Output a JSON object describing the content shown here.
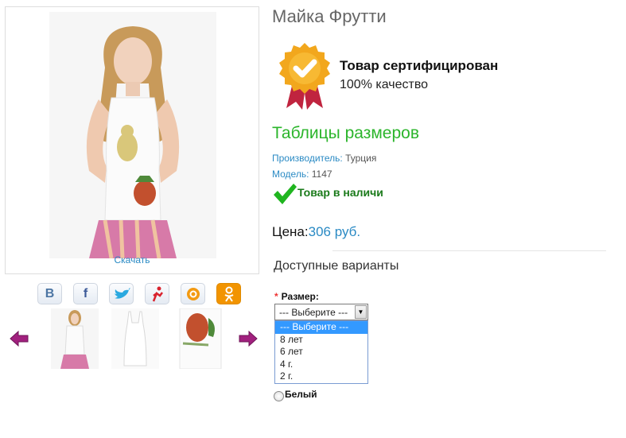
{
  "product": {
    "title": "Майка Фрутти",
    "download_label": "Скачать"
  },
  "social": [
    {
      "name": "vk-icon",
      "glyph": "В",
      "color": "#4c75a3"
    },
    {
      "name": "facebook-icon",
      "glyph": "f",
      "color": "#3b5998"
    },
    {
      "name": "twitter-icon",
      "glyph": "🐦",
      "color": "#2aa9e0"
    },
    {
      "name": "moimir-icon",
      "glyph": "я",
      "color": "#d9232e"
    },
    {
      "name": "mailru-icon",
      "glyph": "@",
      "color": "#f39a12"
    },
    {
      "name": "odnoklassniki-icon",
      "glyph": "ок",
      "color": "#ffffff"
    }
  ],
  "certificate": {
    "title": "Товар сертифицирован",
    "subtitle": "100% качество"
  },
  "sizes_link": "Таблицы размеров",
  "meta": {
    "manufacturer_label": "Производитель:",
    "manufacturer": "Турция",
    "model_label": "Модель:",
    "model": "1147"
  },
  "stock": "Товар в наличи",
  "price": {
    "label": "Цена:",
    "value": "306 руб."
  },
  "variants": {
    "heading": "Доступные варианты",
    "size_label": "Размер:",
    "required_mark": "*",
    "selected": "--- Выберите ---",
    "options": [
      "--- Выберите ---",
      "8 лет",
      "6 лет",
      "4 г.",
      "2 г."
    ],
    "color_option": "Белый"
  },
  "colors": {
    "link": "#2a8ac4",
    "green": "#2bb52b",
    "select_highlight": "#3399ff"
  }
}
